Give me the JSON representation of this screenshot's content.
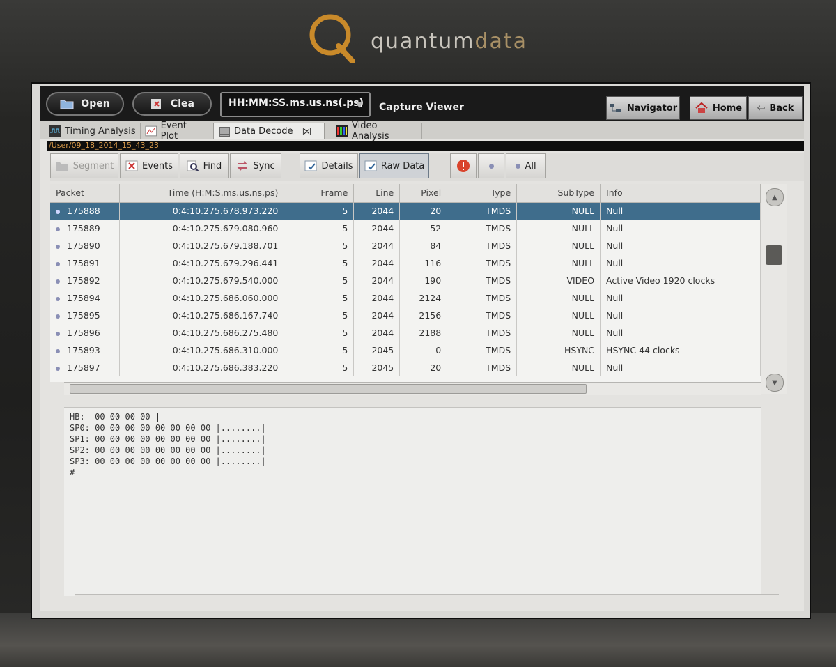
{
  "brand": {
    "name_main": "quantum",
    "name_suffix": "data"
  },
  "toolbar": {
    "open_label": "Open",
    "clear_label": "Clea",
    "time_format": "HH:MM:SS.ms.us.ns(.ps)",
    "title": "Capture Viewer",
    "navigator_label": "Navigator",
    "home_label": "Home",
    "back_label": "Back"
  },
  "tabs": [
    {
      "label": "Timing Analysis"
    },
    {
      "label": "Event Plot"
    },
    {
      "label": "Data Decode",
      "close": "☒"
    },
    {
      "label": "Video Analysis"
    }
  ],
  "path": "/User/09_18_2014_15_43_23",
  "subbar": {
    "segment_label": "Segment",
    "events_label": "Events",
    "find_label": "Find",
    "sync_label": "Sync",
    "details_label": "Details",
    "raw_data_label": "Raw Data",
    "all_label": "All"
  },
  "table": {
    "headers": [
      "Packet",
      "Time (H:M:S.ms.us.ns.ps)",
      "Frame",
      "Line",
      "Pixel",
      "Type",
      "SubType",
      "Info"
    ],
    "rows": [
      [
        "175888",
        "0:4:10.275.678.973.220",
        "5",
        "2044",
        "20",
        "TMDS",
        "NULL",
        "Null"
      ],
      [
        "175889",
        "0:4:10.275.679.080.960",
        "5",
        "2044",
        "52",
        "TMDS",
        "NULL",
        "Null"
      ],
      [
        "175890",
        "0:4:10.275.679.188.701",
        "5",
        "2044",
        "84",
        "TMDS",
        "NULL",
        "Null"
      ],
      [
        "175891",
        "0:4:10.275.679.296.441",
        "5",
        "2044",
        "116",
        "TMDS",
        "NULL",
        "Null"
      ],
      [
        "175892",
        "0:4:10.275.679.540.000",
        "5",
        "2044",
        "190",
        "TMDS",
        "VIDEO",
        "Active Video 1920 clocks"
      ],
      [
        "175894",
        "0:4:10.275.686.060.000",
        "5",
        "2044",
        "2124",
        "TMDS",
        "NULL",
        "Null"
      ],
      [
        "175895",
        "0:4:10.275.686.167.740",
        "5",
        "2044",
        "2156",
        "TMDS",
        "NULL",
        "Null"
      ],
      [
        "175896",
        "0:4:10.275.686.275.480",
        "5",
        "2044",
        "2188",
        "TMDS",
        "NULL",
        "Null"
      ],
      [
        "175893",
        "0:4:10.275.686.310.000",
        "5",
        "2045",
        "0",
        "TMDS",
        "HSYNC",
        "HSYNC 44 clocks"
      ],
      [
        "175897",
        "0:4:10.275.686.383.220",
        "5",
        "2045",
        "20",
        "TMDS",
        "NULL",
        "Null"
      ]
    ]
  },
  "raw": {
    "lines": [
      "HB:  00 00 00 00 |",
      "SP0: 00 00 00 00 00 00 00 00 |........|",
      "SP1: 00 00 00 00 00 00 00 00 |........|",
      "SP2: 00 00 00 00 00 00 00 00 |........|",
      "SP3: 00 00 00 00 00 00 00 00 |........|",
      "#"
    ]
  },
  "colors": {
    "selection": "#3f6d8c",
    "path_text": "#d89a4a",
    "brand_accent": "#c98a2a"
  },
  "icons": [
    "folder-icon",
    "clear-icon",
    "dropdown-arrow-icon",
    "navigator-icon",
    "home-icon",
    "back-arrow-icon",
    "timing-icon",
    "event-plot-icon",
    "data-decode-icon",
    "video-analysis-icon",
    "segment-icon",
    "events-icon",
    "find-icon",
    "sync-icon",
    "details-icon",
    "raw-data-icon",
    "alert-icon",
    "dot-icon"
  ]
}
